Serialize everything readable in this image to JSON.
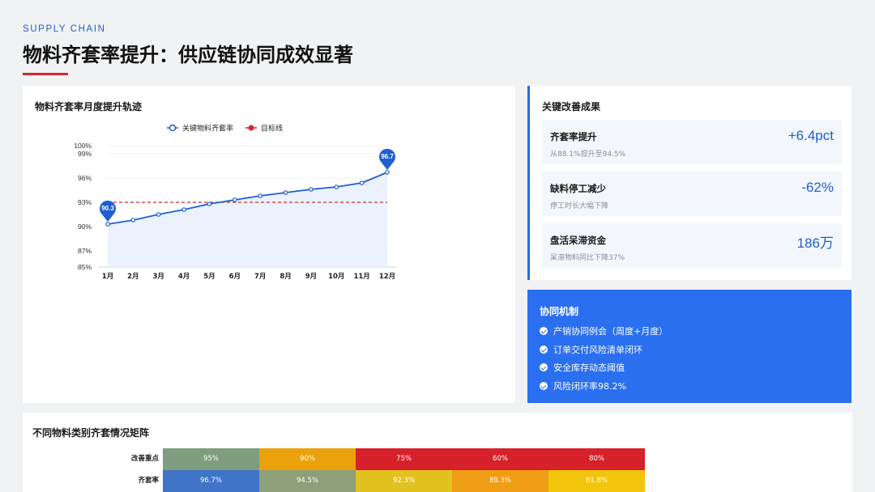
{
  "header": {
    "kicker": "SUPPLY CHAIN",
    "title": "物料齐套率提升：供应链协同成效显著"
  },
  "chart_section": {
    "title": "物料齐套率月度提升轨迹",
    "chart_data": {
      "type": "line",
      "title": "",
      "x": [
        "1月",
        "2月",
        "3月",
        "4月",
        "5月",
        "6月",
        "7月",
        "8月",
        "9月",
        "10月",
        "11月",
        "12月"
      ],
      "series": [
        {
          "name": "关键物料齐套率",
          "values": [
            90.3,
            90.8,
            91.5,
            92.1,
            92.8,
            93.3,
            93.8,
            94.2,
            94.6,
            94.9,
            95.4,
            96.7
          ],
          "color": "#1e5fd1"
        },
        {
          "name": "目标线",
          "values": [
            93,
            93,
            93,
            93,
            93,
            93,
            93,
            93,
            93,
            93,
            93,
            93
          ],
          "color": "#d8262c",
          "style": "dashed"
        }
      ],
      "yticks": [
        "85%",
        "87%",
        "90%",
        "93%",
        "96%",
        "99%",
        "100%"
      ],
      "ylim": [
        85,
        100
      ],
      "annotations": [
        {
          "month": "1月",
          "label": "90.3"
        },
        {
          "month": "12月",
          "label": "96.7"
        }
      ],
      "legend_position": "top-center",
      "area_fill": true
    }
  },
  "results": {
    "title": "关键改善成果",
    "items": [
      {
        "label": "齐套率提升",
        "sub": "从88.1%提升至94.5%",
        "value": "+6.4pct"
      },
      {
        "label": "缺料停工减少",
        "sub": "停工时长大幅下降",
        "value": "-62%"
      },
      {
        "label": "盘活呆滞资金",
        "sub": "呆滞物料同比下降37%",
        "value": "186万"
      }
    ]
  },
  "mechanism": {
    "title": "协同机制",
    "items": [
      "产销协同例会（周度+月度）",
      "订单交付风险清单闭环",
      "安全库存动态阈值",
      "风险闭环率98.2%"
    ]
  },
  "matrix": {
    "title": "不同物料类别齐套情况矩阵",
    "rows": [
      {
        "label": "改善重点",
        "cells": [
          {
            "text": "95%",
            "color": "#7f9d7f"
          },
          {
            "text": "90%",
            "color": "#eaa20c"
          },
          {
            "text": "75%",
            "color": "#d6212a"
          },
          {
            "text": "60%",
            "color": "#d6212a"
          },
          {
            "text": "80%",
            "color": "#d6212a"
          }
        ]
      },
      {
        "label": "齐套率",
        "cells": [
          {
            "text": "96.7%",
            "color": "#3f74c9"
          },
          {
            "text": "94.5%",
            "color": "#8e9f79"
          },
          {
            "text": "92.3%",
            "color": "#e2c21e"
          },
          {
            "text": "89.3%",
            "color": "#ef9d14"
          },
          {
            "text": "81.8%",
            "color": "#f2c40c"
          }
        ]
      }
    ]
  }
}
